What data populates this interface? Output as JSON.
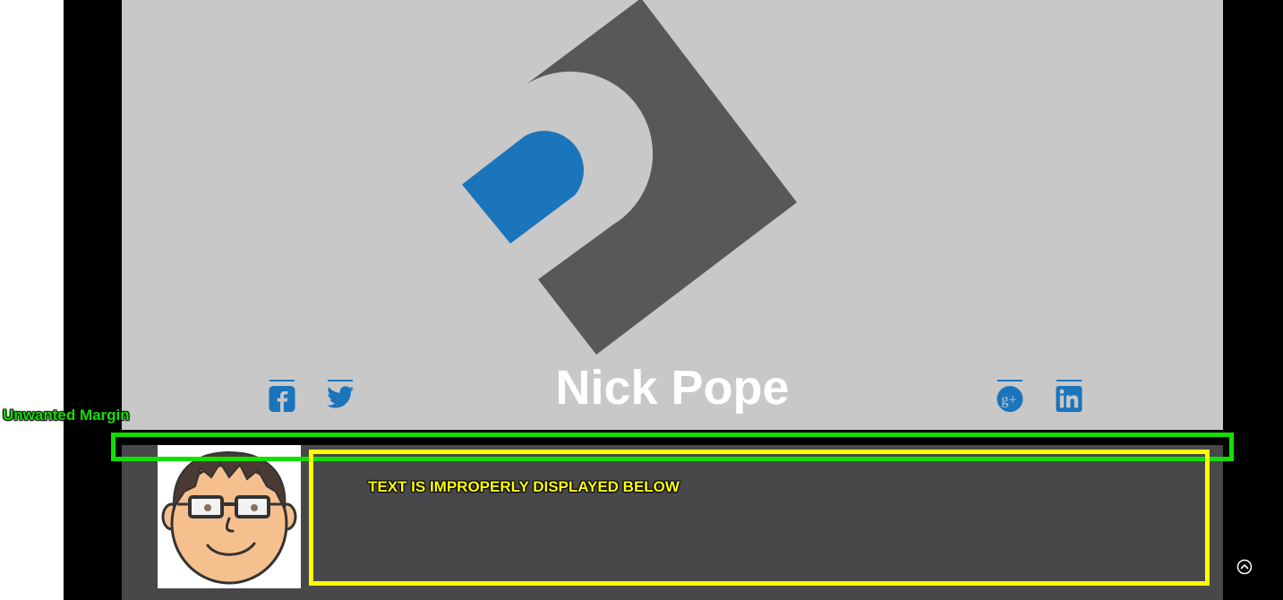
{
  "site": {
    "title": "Nick Pope"
  },
  "social": {
    "facebook_icon": "facebook-icon",
    "twitter_icon": "twitter-icon",
    "googleplus_icon": "google-plus-icon",
    "linkedin_icon": "linkedin-icon"
  },
  "annotations": {
    "margin_label": "Unwanted Margin",
    "text_label": "TEXT IS IMPROPERLY DISPLAYED BELOW"
  },
  "colors": {
    "header_bg": "#c8c8c8",
    "logo_dark": "#58585a",
    "logo_blue": "#1b75bb",
    "content_bg": "#48484a",
    "annotation_green": "#13e000",
    "annotation_yellow": "#ffff00"
  },
  "controls": {
    "back_to_top_icon": "chevron-up-circle-icon"
  }
}
